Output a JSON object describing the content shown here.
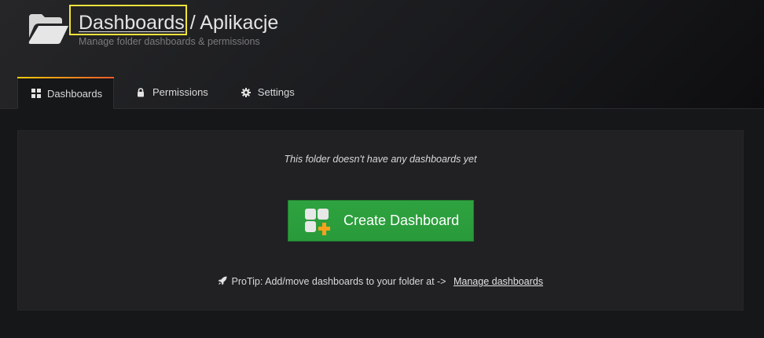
{
  "header": {
    "breadcrumb_label": "Dashboards",
    "title_separator": " / Aplikacje",
    "subtitle": "Manage folder dashboards & permissions",
    "folder_icon": "folder-open-icon"
  },
  "tabs": [
    {
      "label": "Dashboards",
      "icon": "grid-icon",
      "active": true
    },
    {
      "label": "Permissions",
      "icon": "lock-icon",
      "active": false
    },
    {
      "label": "Settings",
      "icon": "gear-icon",
      "active": false
    }
  ],
  "empty_state": {
    "message": "This folder doesn't have any dashboards yet",
    "button_label": "Create Dashboard",
    "protip_text": "ProTip: Add/move dashboards to your folder at ->",
    "protip_link": "Manage dashboards"
  },
  "colors": {
    "accent_orange": "#f05a28",
    "button_green": "#299a3a",
    "highlight_yellow": "#f0e33a"
  }
}
